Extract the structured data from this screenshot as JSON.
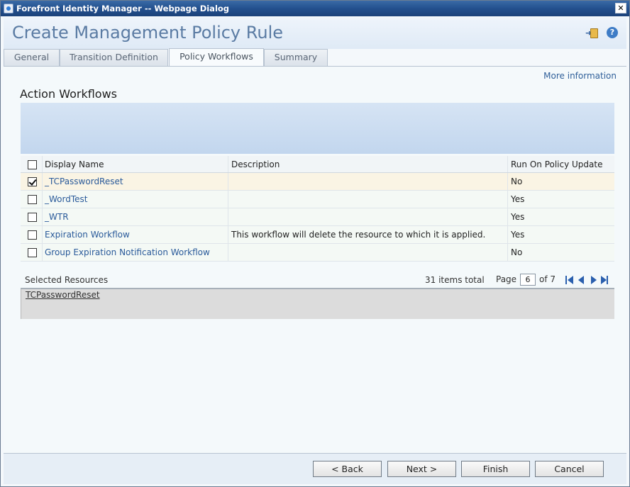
{
  "window": {
    "title": "Forefront Identity Manager -- Webpage Dialog",
    "close_label": "✕"
  },
  "header": {
    "page_title": "Create Management Policy Rule",
    "help_icon_label": "?"
  },
  "tabs": [
    {
      "label": "General",
      "active": false
    },
    {
      "label": "Transition Definition",
      "active": false
    },
    {
      "label": "Policy Workflows",
      "active": true
    },
    {
      "label": "Summary",
      "active": false
    }
  ],
  "content": {
    "more_information": "More information",
    "section_title": "Action Workflows"
  },
  "grid": {
    "columns": {
      "display_name": "Display Name",
      "description": "Description",
      "run_on_policy_update": "Run On Policy Update"
    },
    "rows": [
      {
        "display_name": "_TCPasswordReset",
        "description": "",
        "run_on_policy_update": "No",
        "checked": true
      },
      {
        "display_name": "_WordTest",
        "description": "",
        "run_on_policy_update": "Yes",
        "checked": false
      },
      {
        "display_name": "_WTR",
        "description": "",
        "run_on_policy_update": "Yes",
        "checked": false
      },
      {
        "display_name": "Expiration Workflow",
        "description": "This workflow will delete the resource to which it is applied.",
        "run_on_policy_update": "Yes",
        "checked": false
      },
      {
        "display_name": "Group Expiration Notification Workflow",
        "description": "",
        "run_on_policy_update": "No",
        "checked": false
      }
    ]
  },
  "pager": {
    "selected_label": "Selected Resources",
    "items_total": "31 items total",
    "page_label": "Page",
    "page_value": "6",
    "of_label": "of 7"
  },
  "selected_resources": [
    "TCPasswordReset"
  ],
  "footer": {
    "back": "< Back",
    "next": "Next >",
    "finish": "Finish",
    "cancel": "Cancel"
  }
}
